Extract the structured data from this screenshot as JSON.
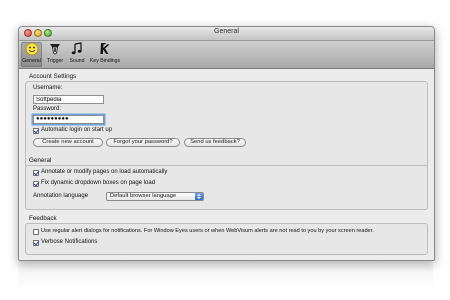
{
  "window": {
    "title": "General"
  },
  "toolbar": {
    "items": [
      {
        "label": "General",
        "icon": "smiley-icon",
        "selected": true
      },
      {
        "label": "Trigger",
        "icon": "trigger-icon",
        "selected": false
      },
      {
        "label": "Sound",
        "icon": "music-note-icon",
        "selected": false
      },
      {
        "label": "Key Bindings",
        "icon": "keyboard-key-icon",
        "selected": false
      }
    ]
  },
  "account": {
    "title": "Account Settings",
    "username_label": "Username:",
    "username_value": "Softpedia",
    "password_label": "Password:",
    "password_value": "●●●●●●●●●",
    "auto_login_label": "Automatic login on start up",
    "auto_login_checked": true,
    "create_button": "Create new account",
    "forgot_button": "Forgot your password?",
    "feedback_button": "Send us feedback?"
  },
  "general": {
    "title": "General",
    "annotate_label": "Annotate or modify pages on load automatically",
    "annotate_checked": true,
    "fix_dropdown_label": "Fix dynamic dropdown boxes on page load",
    "fix_dropdown_checked": true,
    "annotation_language_label": "Annotation language",
    "annotation_language_value": "Default browser language"
  },
  "feedback": {
    "title": "Feedback",
    "regular_alert_label": "Use regular alert dialogs for notifications. For Window Eyes users or when WebVisum alerts are not read to you by your screen reader.",
    "regular_alert_checked": false,
    "verbose_label": "Verbose Notifications",
    "verbose_checked": true
  },
  "colors": {
    "focus_ring": "#6da3de",
    "accent": "#2f6ccc"
  }
}
